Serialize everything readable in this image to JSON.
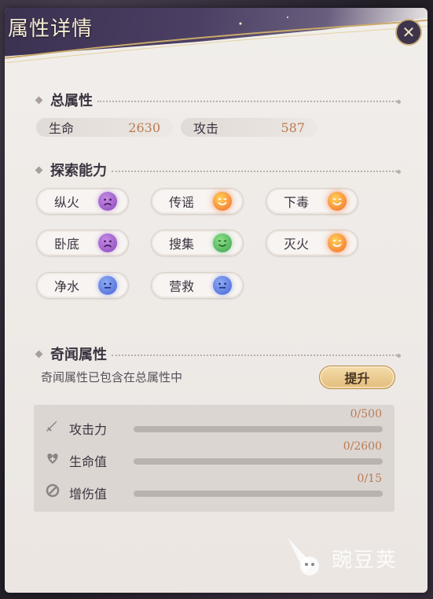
{
  "header": {
    "title": "属性详情",
    "close_icon": "close-star-icon"
  },
  "total_attributes": {
    "title": "总属性",
    "stats": [
      {
        "label": "生命",
        "value": "2630"
      },
      {
        "label": "攻击",
        "value": "587"
      }
    ]
  },
  "exploration": {
    "title": "探索能力",
    "skills": [
      {
        "label": "纵火",
        "mood": "sad",
        "color": "purple"
      },
      {
        "label": "传谣",
        "mood": "happy",
        "color": "orange"
      },
      {
        "label": "下毒",
        "mood": "happy",
        "color": "orange"
      },
      {
        "label": "卧底",
        "mood": "sad",
        "color": "purple"
      },
      {
        "label": "搜集",
        "mood": "smile",
        "color": "green"
      },
      {
        "label": "灭火",
        "mood": "happy",
        "color": "orange"
      },
      {
        "label": "净水",
        "mood": "neutral",
        "color": "blue"
      },
      {
        "label": "营救",
        "mood": "neutral",
        "color": "blue"
      }
    ]
  },
  "curio": {
    "title": "奇闻属性",
    "description": "奇闻属性已包含在总属性中",
    "boost_label": "提升",
    "bonuses": [
      {
        "label": "攻击力",
        "value": "0/500",
        "icon": "sword-icon",
        "progress": 0
      },
      {
        "label": "生命值",
        "value": "0/2600",
        "icon": "heart-plus-icon",
        "progress": 0
      },
      {
        "label": "增伤值",
        "value": "0/15",
        "icon": "damage-boost-icon",
        "progress": 0
      }
    ]
  },
  "watermark": {
    "text": "豌豆荚"
  }
}
